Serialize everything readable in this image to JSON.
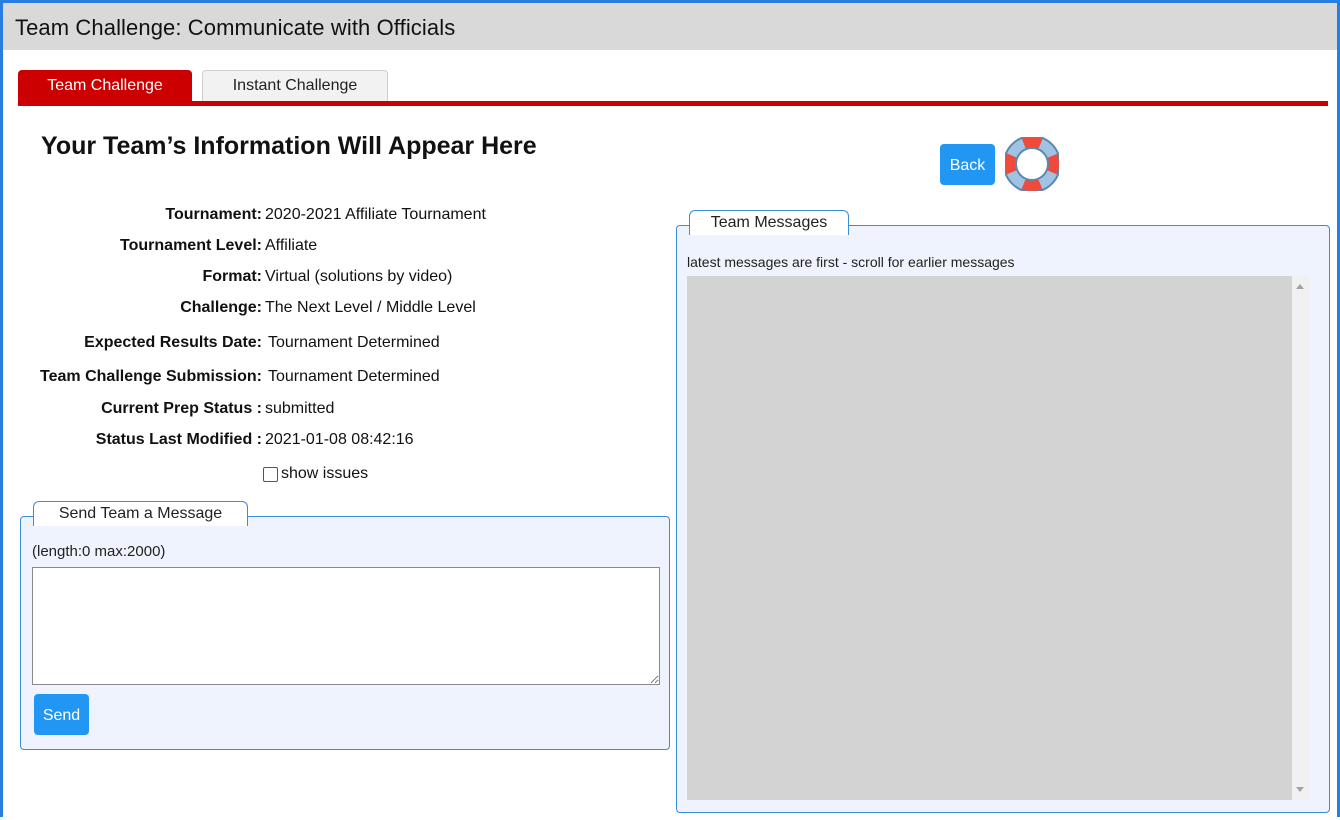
{
  "header": {
    "title": "Team Challenge: Communicate with Officials"
  },
  "tabs": [
    {
      "label": "Team Challenge",
      "active": true
    },
    {
      "label": "Instant Challenge",
      "active": false
    }
  ],
  "colors": {
    "accent_red": "#cc0000",
    "button_blue": "#2196f3",
    "panel_border": "#3a8ed8",
    "panel_bg": "#eef3fd"
  },
  "main": {
    "heading": "Your Team’s Information Will Appear Here",
    "info": [
      {
        "label": "Tournament:",
        "value": "2020-2021 Affiliate Tournament"
      },
      {
        "label": "Tournament Level:",
        "value": "Affiliate"
      },
      {
        "label": "Format:",
        "value": "Virtual (solutions by video)"
      },
      {
        "label": "Challenge:",
        "value": "The Next Level / Middle Level"
      },
      {
        "label": "Expected Results Date:",
        "value": "Tournament Determined"
      },
      {
        "label": "Team Challenge Submission:",
        "value": "Tournament Determined"
      },
      {
        "label": "Current Prep Status :",
        "value": "submitted"
      },
      {
        "label": "Status Last Modified :",
        "value": "2021-01-08 08:42:16"
      }
    ],
    "show_issues_label": "show issues",
    "show_issues_checked": false
  },
  "send_panel": {
    "legend": "Send Team a Message",
    "length_note": "(length:0 max:2000)",
    "message_value": "",
    "send_label": "Send"
  },
  "actions": {
    "back_label": "Back",
    "help_icon": "lifering-icon"
  },
  "messages_panel": {
    "legend": "Team Messages",
    "note": "latest messages are first - scroll for earlier messages"
  }
}
